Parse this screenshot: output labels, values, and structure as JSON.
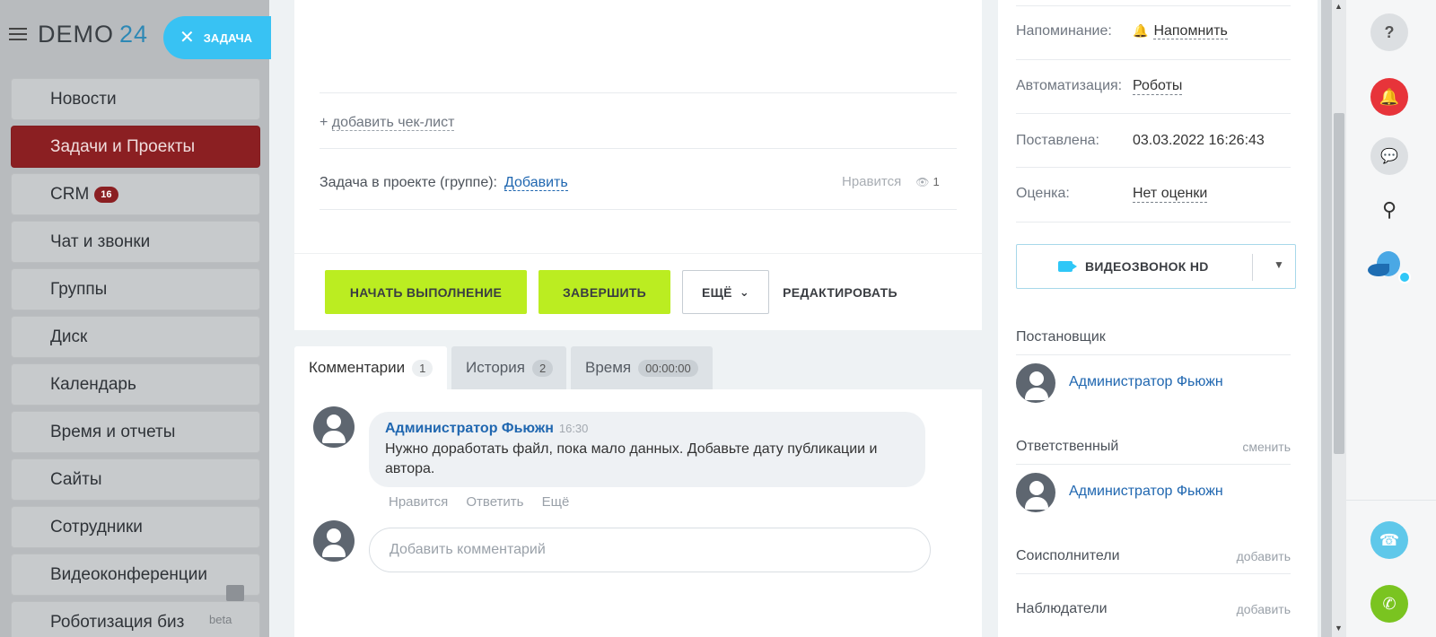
{
  "portal": {
    "logo_text": "DEMO",
    "logo_num": "24",
    "task_pill": "ЗАДАЧА",
    "beta": "beta",
    "menu": [
      {
        "label": "Новости",
        "badge": ""
      },
      {
        "label": "Задачи и Проекты",
        "badge": ""
      },
      {
        "label": "CRM",
        "badge": "16"
      },
      {
        "label": "Чат и звонки",
        "badge": ""
      },
      {
        "label": "Группы",
        "badge": ""
      },
      {
        "label": "Диск",
        "badge": ""
      },
      {
        "label": "Календарь",
        "badge": ""
      },
      {
        "label": "Время и отчеты",
        "badge": ""
      },
      {
        "label": "Сайты",
        "badge": ""
      },
      {
        "label": "Сотрудники",
        "badge": ""
      },
      {
        "label": "Видеоконференции",
        "badge": ""
      },
      {
        "label": "Роботизация биз",
        "badge": ""
      }
    ]
  },
  "task": {
    "add_checklist_plus": "+",
    "add_checklist": "добавить чек-лист",
    "project_label": "Задача в проекте (группе):",
    "project_add": "Добавить",
    "like": "Нравится",
    "views": "1"
  },
  "actions": {
    "start": "НАЧАТЬ ВЫПОЛНЕНИЕ",
    "finish": "ЗАВЕРШИТЬ",
    "more": "ЕЩЁ",
    "edit": "РЕДАКТИРОВАТЬ"
  },
  "tabs": [
    {
      "label": "Комментарии",
      "count": "1"
    },
    {
      "label": "История",
      "count": "2"
    },
    {
      "label": "Время",
      "count": "00:00:00"
    }
  ],
  "comment": {
    "author": "Администратор Фьюжн",
    "time": "16:30",
    "text": "Нужно доработать файл, пока мало  данных. Добавьте дату публикации и автора.",
    "actions": [
      "Нравится",
      "Ответить",
      "Ещё"
    ],
    "input_placeholder": "Добавить комментарий"
  },
  "sidebar": {
    "reminder_label": "Напоминание:",
    "reminder_value": "Напомнить",
    "automation_label": "Автоматизация:",
    "automation_value": "Роботы",
    "created_label": "Поставлена:",
    "created_value": "03.03.2022 16:26:43",
    "rating_label": "Оценка:",
    "rating_value": "Нет оценки",
    "videocall": "ВИДЕОЗВОНОК HD",
    "creator_title": "Постановщик",
    "creator_name": "Администратор Фьюжн",
    "responsible_title": "Ответственный",
    "responsible_change": "сменить",
    "responsible_name": "Администратор Фьюжн",
    "coexec_title": "Соисполнители",
    "coexec_add": "добавить",
    "observers_title": "Наблюдатели",
    "observers_add": "добавить"
  },
  "colors": {
    "accent_green": "#bbed21",
    "link_blue": "#2067b0",
    "active_menu": "#8b1f22",
    "task_pill": "#38c2f3"
  }
}
